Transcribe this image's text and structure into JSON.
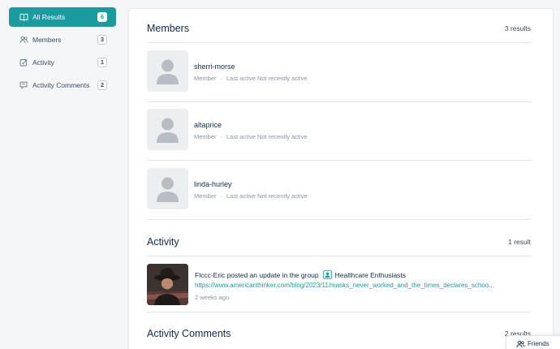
{
  "sidebar": {
    "items": [
      {
        "label": "All Results",
        "count": "6",
        "icon": "book-icon",
        "active": true
      },
      {
        "label": "Members",
        "count": "3",
        "icon": "users-icon",
        "active": false
      },
      {
        "label": "Activity",
        "count": "1",
        "icon": "activity-icon",
        "active": false
      },
      {
        "label": "Activity Comments",
        "count": "2",
        "icon": "comment-icon",
        "active": false
      }
    ]
  },
  "members_section": {
    "title": "Members",
    "count": "3 results",
    "items": [
      {
        "name": "sherri-morse",
        "role": "Member",
        "separator": "·",
        "status": "Last active Not recently active"
      },
      {
        "name": "altaprice",
        "role": "Member",
        "separator": "·",
        "status": "Last active Not recently active"
      },
      {
        "name": "linda-hurley",
        "role": "Member",
        "separator": "·",
        "status": "Last active Not recently active"
      }
    ]
  },
  "activity_section": {
    "title": "Activity",
    "count": "1 result",
    "item": {
      "user": "Flccc-Eric",
      "action": "posted an update in the group",
      "group": "Healthcare Enthusiasts",
      "link": "https://www.americanthinker.com/blog/2023/11/masks_never_worked_and_the_times_declares_schoo...",
      "time": "2 weeks ago"
    }
  },
  "comments_section": {
    "title": "Activity Comments",
    "count": "2 results"
  },
  "friends_tab": {
    "label": "Friends"
  },
  "colors": {
    "accent": "#1a9ba0",
    "text": "#122b46",
    "muted": "#8a949e"
  }
}
